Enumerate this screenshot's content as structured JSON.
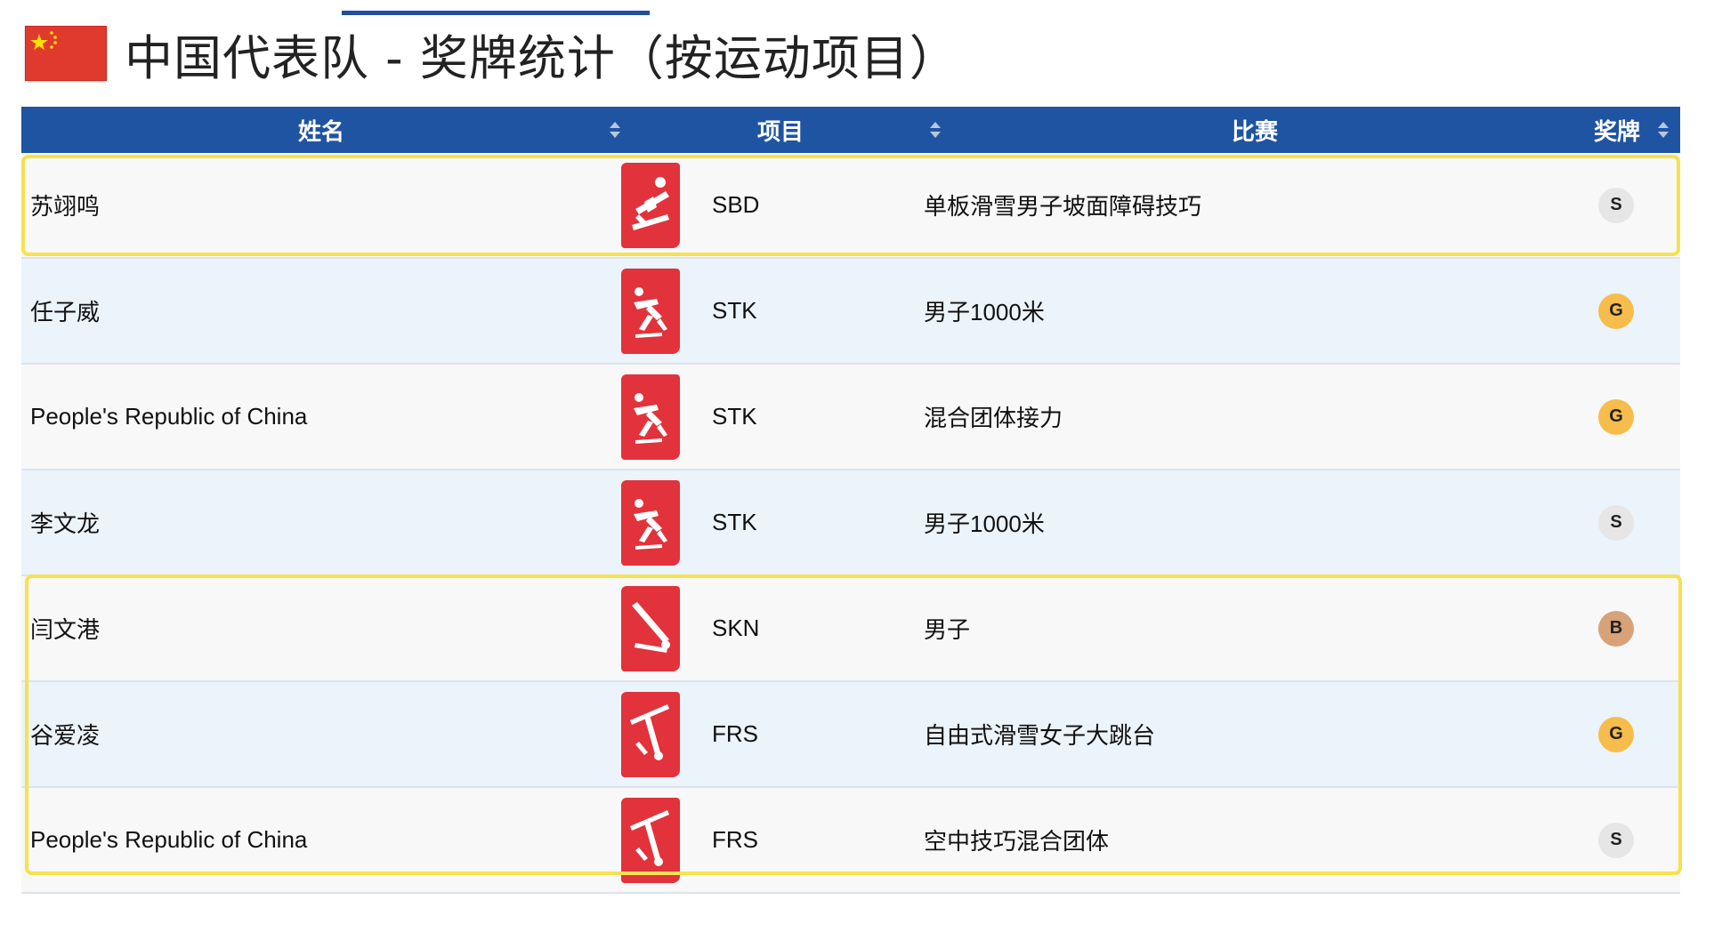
{
  "page": {
    "title": "中国代表队 - 奖牌统计（按运动项目）"
  },
  "colors": {
    "header_bg": "#1f54a3",
    "pictogram": "#e2323c",
    "highlight": "#f6e14e",
    "gold": "#f6bd4c",
    "silver": "#e6e6e6",
    "bronze": "#d7a278"
  },
  "table": {
    "headers": {
      "name": "姓名",
      "sport": "项目",
      "event": "比赛",
      "medal": "奖牌"
    },
    "rows": [
      {
        "name": "苏翊鸣",
        "sport_icon": "snowboard-icon",
        "code": "SBD",
        "event": "单板滑雪男子坡面障碍技巧",
        "medal": "S"
      },
      {
        "name": "任子威",
        "sport_icon": "short-track-icon",
        "code": "STK",
        "event": "男子1000米",
        "medal": "G"
      },
      {
        "name": "People's Republic of China",
        "sport_icon": "short-track-icon",
        "code": "STK",
        "event": "混合团体接力",
        "medal": "G"
      },
      {
        "name": "李文龙",
        "sport_icon": "short-track-icon",
        "code": "STK",
        "event": "男子1000米",
        "medal": "S"
      },
      {
        "name": "闫文港",
        "sport_icon": "skeleton-icon",
        "code": "SKN",
        "event": "男子",
        "medal": "B"
      },
      {
        "name": "谷爱凌",
        "sport_icon": "freestyle-ski-icon",
        "code": "FRS",
        "event": "自由式滑雪女子大跳台",
        "medal": "G"
      },
      {
        "name": "People's Republic of China",
        "sport_icon": "freestyle-ski-icon",
        "code": "FRS",
        "event": "空中技巧混合团体",
        "medal": "S"
      }
    ]
  }
}
